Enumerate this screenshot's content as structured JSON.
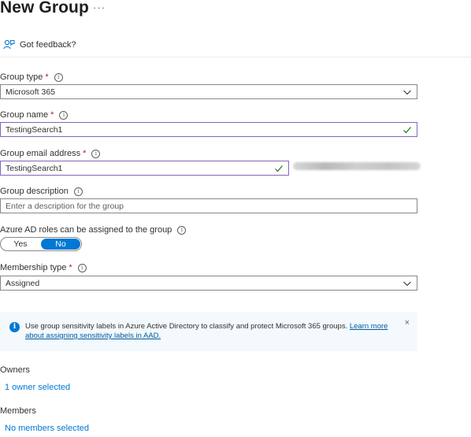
{
  "header": {
    "title": "New Group",
    "more_label": "···"
  },
  "feedback": {
    "label": "Got feedback?"
  },
  "form": {
    "group_type": {
      "label": "Group type",
      "required_mark": "*",
      "value": "Microsoft 365"
    },
    "group_name": {
      "label": "Group name",
      "required_mark": "*",
      "value": "TestingSearch1"
    },
    "group_email": {
      "label": "Group email address",
      "required_mark": "*",
      "value": "TestingSearch1"
    },
    "group_description": {
      "label": "Group description",
      "placeholder": "Enter a description for the group"
    },
    "azure_ad_roles": {
      "label": "Azure AD roles can be assigned to the group",
      "options": [
        "Yes",
        "No"
      ],
      "selected": "No"
    },
    "membership_type": {
      "label": "Membership type",
      "required_mark": "*",
      "value": "Assigned"
    }
  },
  "banner": {
    "message": "Use group sensitivity labels in Azure Active Directory to classify and protect Microsoft 365 groups.",
    "link_text": "Learn more about assigning sensitivity labels in AAD.",
    "close_label": "×"
  },
  "owners": {
    "heading": "Owners",
    "link": "1 owner selected"
  },
  "members": {
    "heading": "Members",
    "link": "No members selected"
  },
  "colors": {
    "accent": "#0078d4",
    "valid_border": "#8764b8",
    "valid_check": "#107c10",
    "required": "#a4262c",
    "banner_bg": "#f3f9fd"
  }
}
